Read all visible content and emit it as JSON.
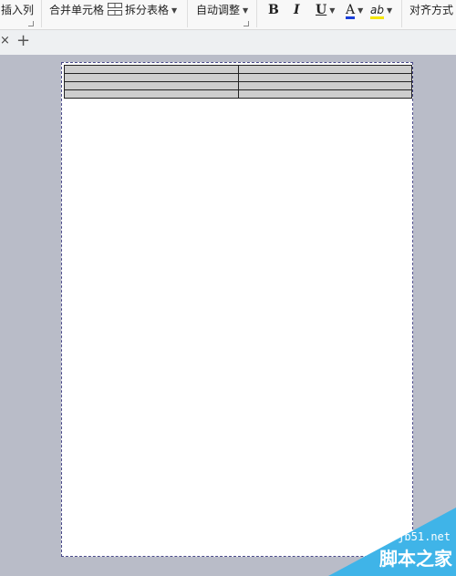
{
  "toolbar": {
    "insert_column": "插入列",
    "merge_cells": "合并单元格",
    "split_table": "拆分表格",
    "auto_adjust": "自动调整",
    "bold": "B",
    "italic": "I",
    "underline": "U",
    "font_color_glyph": "A",
    "highlight_glyph": "ab",
    "alignment": "对齐方式",
    "font_color": "#1a3fd9",
    "highlight_color": "#f5e600"
  },
  "tabs": {
    "close_glyph": "×",
    "add_glyph": "+"
  },
  "document": {
    "table": {
      "rows": 4,
      "columns": 2,
      "cell_fill": "#cdcdcd"
    }
  },
  "watermark": {
    "site": "jb51.net",
    "name": "脚本之家"
  }
}
